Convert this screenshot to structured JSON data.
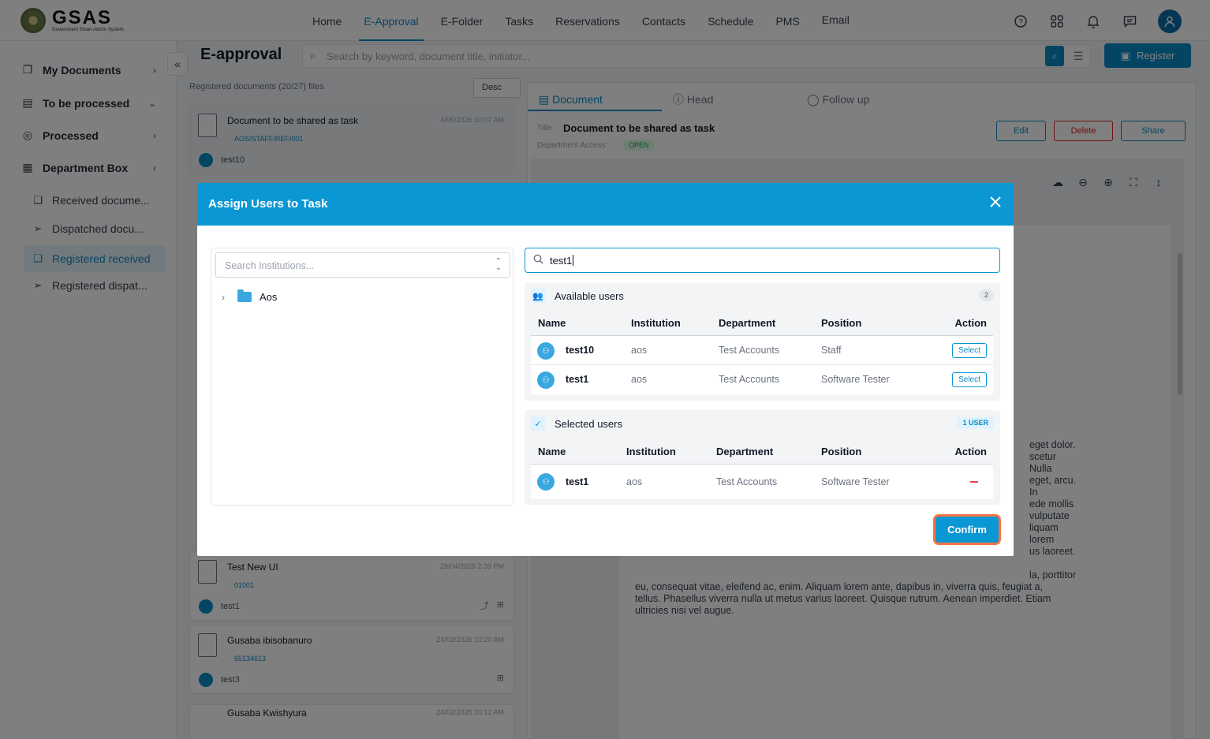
{
  "app": {
    "logo_text": "GSAS",
    "logo_subtitle": "Government Smart Admin System"
  },
  "nav": {
    "items": [
      "Home",
      "E-Approval",
      "E-Folder",
      "Tasks",
      "Reservations",
      "Contacts",
      "Schedule",
      "PMS",
      "Email"
    ],
    "active": "E-Approval"
  },
  "sidebar": {
    "main_items": [
      {
        "label": "My Documents",
        "icon": "documents-icon",
        "chevron": "›"
      },
      {
        "label": "To be processed",
        "icon": "clipboard-icon",
        "chevron": "⌄"
      },
      {
        "label": "Processed",
        "icon": "check-circle-icon",
        "chevron": "›"
      },
      {
        "label": "Department Box",
        "icon": "building-icon",
        "chevron": "‹"
      }
    ],
    "sub_items": [
      {
        "label": "Received docume...",
        "icon": "copy-icon"
      },
      {
        "label": "Dispatched docu...",
        "icon": "send-icon"
      },
      {
        "label": "Registered received",
        "icon": "copy-icon",
        "active": true
      },
      {
        "label": "Registered dispat...",
        "icon": "send-icon"
      }
    ]
  },
  "header": {
    "page_title": "E-approval",
    "search_placeholder": "Search by keyword, document title, initiator...",
    "register_label": "Register"
  },
  "doc_list": {
    "meta": "Registered documents (20/27) files",
    "sort": "Desc",
    "cards": [
      {
        "title": "Document to be shared as task",
        "date": "4/06/2026 10:07 AM",
        "ref": "AOS/STAFF/REF/001",
        "user": "test10"
      },
      {
        "title": "Test New UI",
        "date": "29/04/2026 2:39 PM",
        "ref": "01001",
        "user": "test1"
      },
      {
        "title": "Gusaba ibisobanuro",
        "date": "24/02/2026 10:20 AM",
        "ref": "65134613",
        "user": "test3"
      },
      {
        "title": "Gusaba Kwishyura",
        "date": "24/02/2026 10:12 AM",
        "ref": "",
        "user": ""
      }
    ]
  },
  "doc_pane": {
    "tabs": [
      "Document",
      "Head",
      "Follow up"
    ],
    "title_label": "Title:",
    "title": "Document to be shared as task",
    "dept_label": "Department Access:",
    "dept_status": "OPEN",
    "buttons": {
      "edit": "Edit",
      "delete": "Delete",
      "share": "Share"
    },
    "body_text_visible": [
      "eget dolor.",
      "scetur",
      "Nulla",
      "eget, arcu. In",
      "ede mollis",
      "vulputate",
      "liquam lorem",
      "us laoreet.",
      "la, porttitor",
      "eu, consequat vitae, eleifend ac, enim. Aliquam lorem ante, dapibus in, viverra quis, feugiat a,",
      "tellus. Phasellus viverra nulla ut metus varius laoreet. Quisque rutrum. Aenean imperdiet. Etiam",
      "ultricies nisi vel augue."
    ]
  },
  "modal": {
    "title": "Assign Users to Task",
    "institution_search_placeholder": "Search Institutions...",
    "tree": [
      {
        "label": "Aos"
      }
    ],
    "user_search_value": "test1",
    "available": {
      "title": "Available users",
      "count": "2",
      "columns": [
        "Name",
        "Institution",
        "Department",
        "Position",
        "Action"
      ],
      "rows": [
        {
          "name": "test10",
          "institution": "aos",
          "department": "Test Accounts",
          "position": "Staff",
          "action": "Select"
        },
        {
          "name": "test1",
          "institution": "aos",
          "department": "Test Accounts",
          "position": "Software Tester",
          "action": "Select"
        }
      ]
    },
    "selected": {
      "title": "Selected users",
      "count": "1 USER",
      "columns": [
        "Name",
        "Institution",
        "Department",
        "Position",
        "Action"
      ],
      "rows": [
        {
          "name": "test1",
          "institution": "aos",
          "department": "Test Accounts",
          "position": "Software Tester"
        }
      ]
    },
    "confirm_label": "Confirm"
  },
  "colors": {
    "accent": "#0a97d4",
    "danger": "#ef4444",
    "confirm_outline": "#f97342"
  }
}
